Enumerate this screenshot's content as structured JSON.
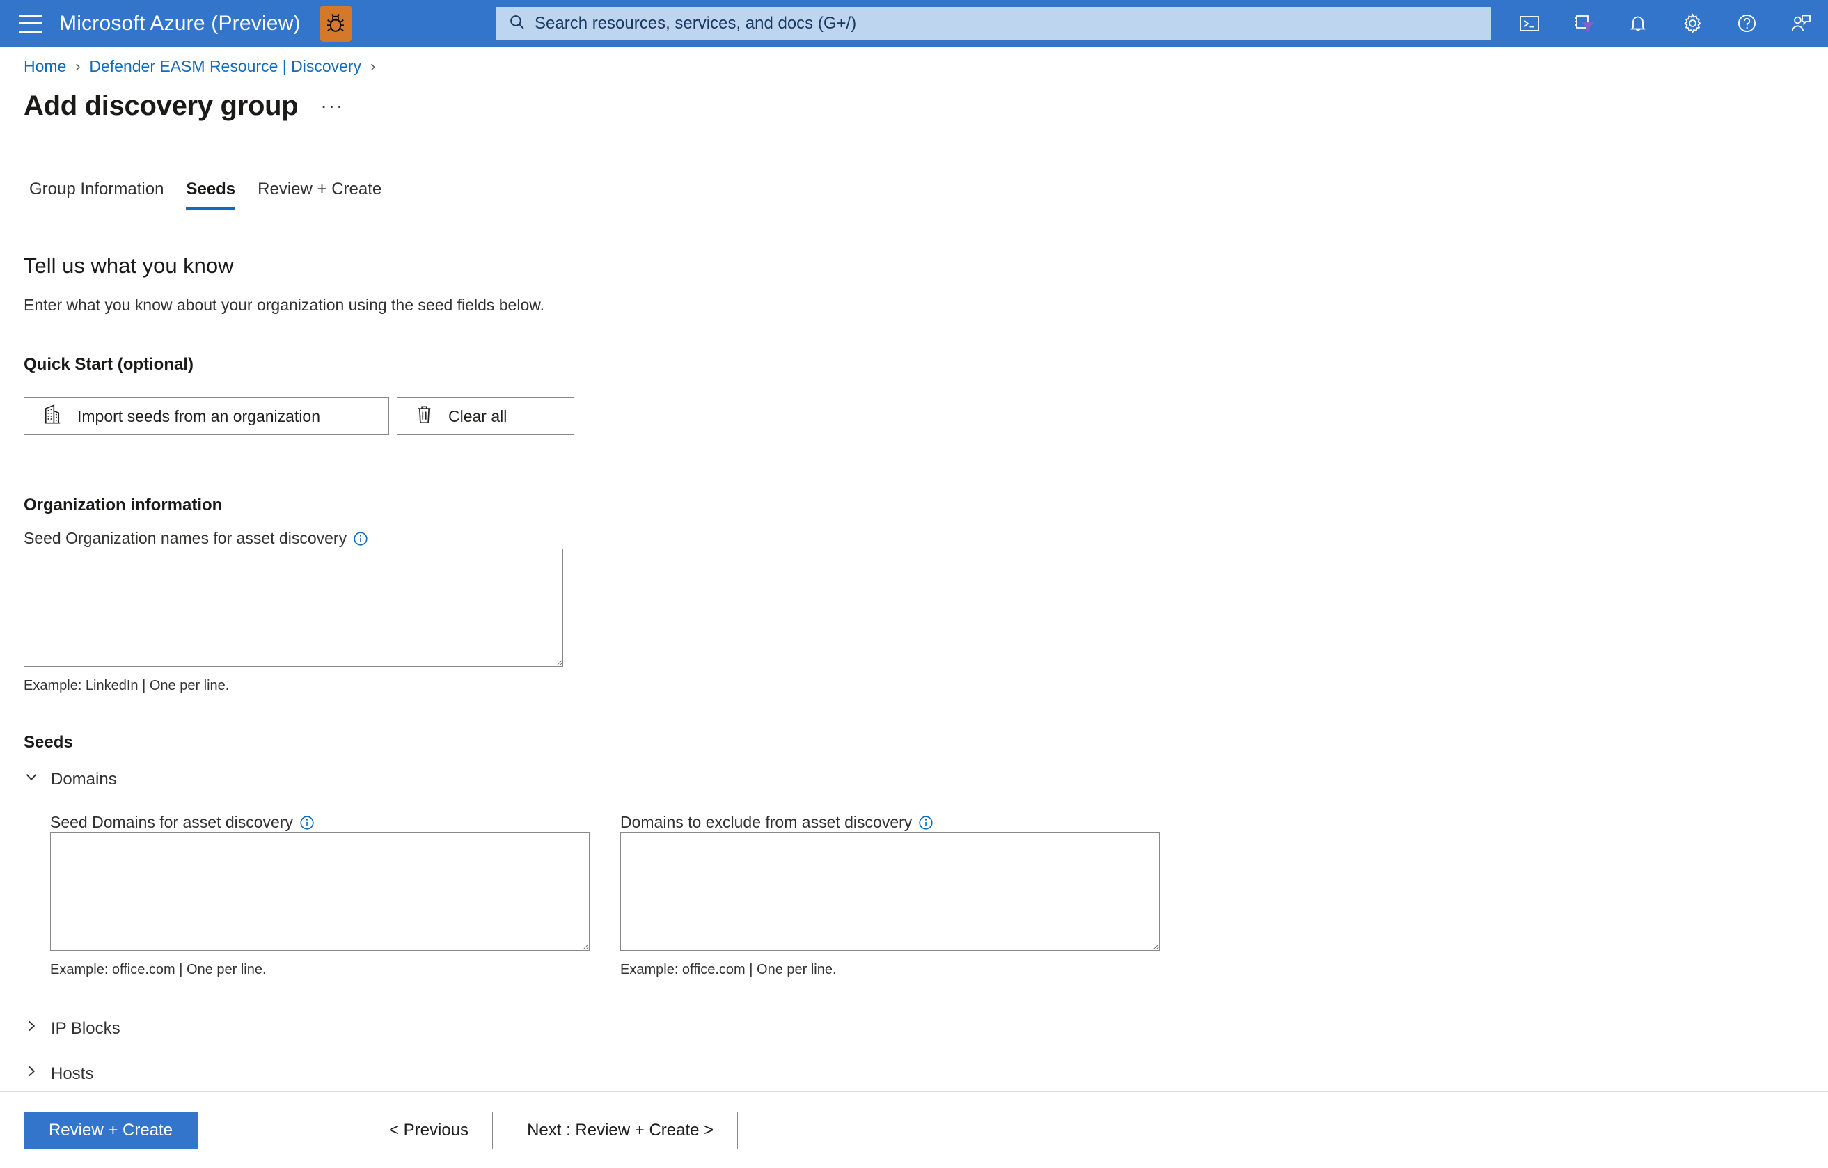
{
  "topbar": {
    "menu_icon": "hamburger-icon",
    "brand": "Microsoft Azure (Preview)",
    "bug_icon": "bug-icon",
    "bug_badge_color": "#d4792a",
    "bar_color": "#3275ca",
    "search": {
      "icon": "search-icon",
      "placeholder": "Search resources, services, and docs (G+/)",
      "value": "",
      "background": "#bdd5ee"
    },
    "actions": [
      {
        "name": "cloud-shell-icon",
        "label": "Cloud Shell"
      },
      {
        "name": "directory-subscription-filter-icon",
        "label": "Directories + subscriptions"
      },
      {
        "name": "notifications-bell-icon",
        "label": "Notifications"
      },
      {
        "name": "settings-gear-icon",
        "label": "Settings"
      },
      {
        "name": "help-question-icon",
        "label": "Help"
      },
      {
        "name": "feedback-person-icon",
        "label": "Feedback"
      }
    ]
  },
  "breadcrumb": {
    "items": [
      {
        "label": "Home"
      },
      {
        "label": "Defender EASM Resource | Discovery"
      }
    ],
    "separator": "›"
  },
  "page": {
    "title": "Add discovery group",
    "more_label": "···"
  },
  "tabs": [
    {
      "label": "Group Information",
      "active": false
    },
    {
      "label": "Seeds",
      "active": true
    },
    {
      "label": "Review + Create",
      "active": false
    }
  ],
  "main": {
    "heading": "Tell us what you know",
    "subheading": "Enter what you know about your organization using the seed fields below.",
    "quick_start": {
      "title": "Quick Start (optional)",
      "import_button": "Import seeds from an organization",
      "import_icon": "organization-building-icon",
      "clear_button": "Clear all",
      "clear_icon": "trash-icon"
    },
    "organization_information": {
      "title": "Organization information",
      "field": {
        "label": "Seed Organization names for asset discovery",
        "info_icon": "info-circle-icon",
        "value": "",
        "placeholder": "",
        "hint": "Example: LinkedIn | One per line."
      }
    },
    "seeds": {
      "title": "Seeds",
      "groups": [
        {
          "name": "Domains",
          "expanded": true,
          "chevron": "chevron-down-icon",
          "fields": [
            {
              "label": "Seed Domains for asset discovery",
              "info_icon": "info-circle-icon",
              "value": "",
              "placeholder": "",
              "hint": "Example: office.com | One per line."
            },
            {
              "label": "Domains to exclude from asset discovery",
              "info_icon": "info-circle-icon",
              "value": "",
              "placeholder": "",
              "hint": "Example: office.com | One per line."
            }
          ]
        },
        {
          "name": "IP Blocks",
          "expanded": false,
          "chevron": "chevron-right-icon",
          "fields": []
        },
        {
          "name": "Hosts",
          "expanded": false,
          "chevron": "chevron-right-icon",
          "fields": []
        }
      ]
    }
  },
  "footer": {
    "primary": "Review + Create",
    "previous": "< Previous",
    "next": "Next : Review + Create >",
    "primary_color": "#3275ca"
  }
}
